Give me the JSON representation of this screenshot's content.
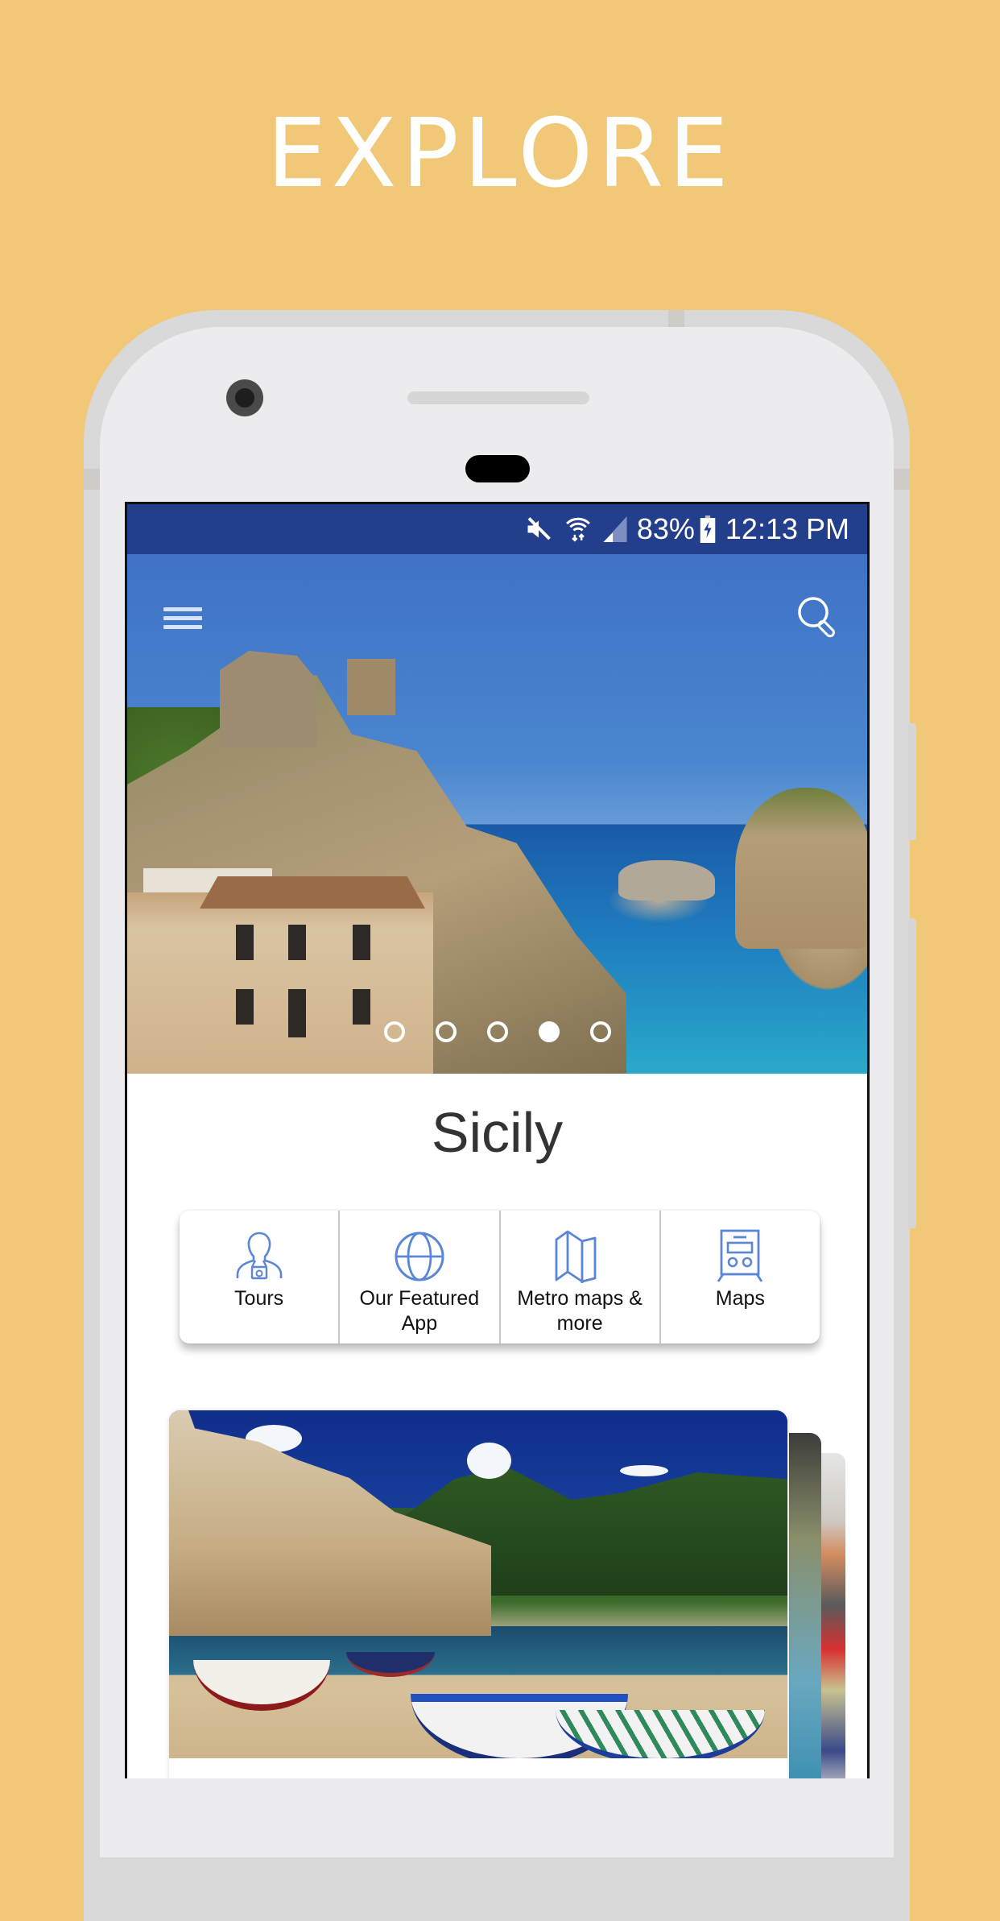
{
  "promo": {
    "headline": "EXPLORE",
    "background_color": "#F1C778"
  },
  "status_bar": {
    "icons": [
      "mute-icon",
      "wifi-icon",
      "signal-icon",
      "battery-charging-icon"
    ],
    "battery": "83%",
    "time": "12:13 PM",
    "color": "#233F8C"
  },
  "app_bar": {
    "menu_icon": "hamburger-menu-icon",
    "search_icon": "search-icon"
  },
  "hero": {
    "image_description": "Coastal cliffs with watchtowers, old building and turquoise sea",
    "carousel_count": 5,
    "carousel_active_index": 3
  },
  "destination": {
    "title": "Sicily"
  },
  "categories": [
    {
      "label": "Tours",
      "icon": "tourist-camera-icon"
    },
    {
      "label": "Our Featured App",
      "icon": "globe-icon"
    },
    {
      "label": "Metro maps & more",
      "icon": "folded-map-icon"
    },
    {
      "label": "Maps",
      "icon": "train-icon"
    }
  ],
  "accent_color": "#5B86D6",
  "cards": [
    {
      "image_description": "Seaside town with beach, boats and mountains"
    }
  ]
}
